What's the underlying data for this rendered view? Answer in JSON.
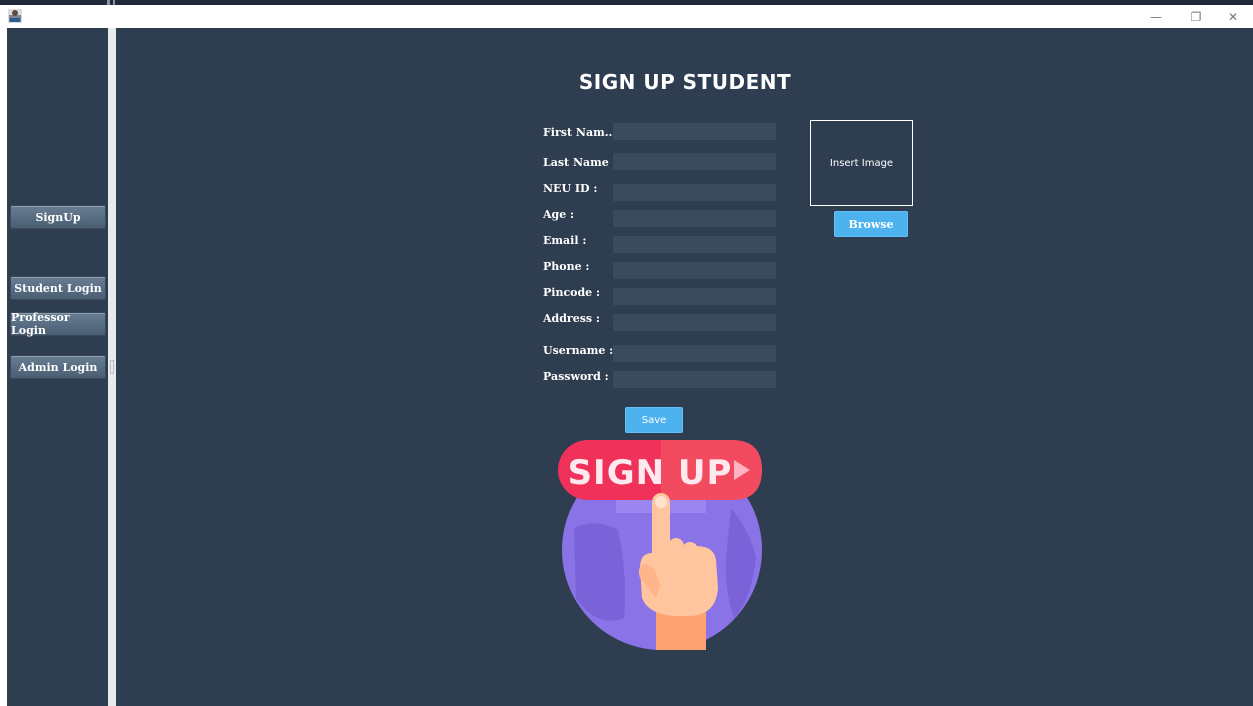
{
  "window": {
    "minimize_glyph": "—",
    "maximize_glyph": "❐",
    "close_glyph": "✕"
  },
  "sidebar": {
    "items": [
      {
        "label": "SignUp"
      },
      {
        "label": "Student Login"
      },
      {
        "label": "Professor Login"
      },
      {
        "label": "Admin Login"
      }
    ]
  },
  "form": {
    "title": "SIGN UP STUDENT",
    "fields": [
      {
        "label": "First Nam...",
        "value": ""
      },
      {
        "label": "Last Name :",
        "value": ""
      },
      {
        "label": "NEU ID :",
        "value": ""
      },
      {
        "label": "Age :",
        "value": ""
      },
      {
        "label": "Email :",
        "value": ""
      },
      {
        "label": "Phone :",
        "value": ""
      },
      {
        "label": "Pincode :",
        "value": ""
      },
      {
        "label": "Address :",
        "value": ""
      },
      {
        "label": "Username :",
        "value": ""
      },
      {
        "label": "Password :",
        "value": ""
      }
    ],
    "image_placeholder": "Insert Image",
    "browse_label": "Browse",
    "save_label": "Save"
  },
  "illustration": {
    "banner_text": "SIGN UP",
    "icon": "hand-pointer-icon"
  },
  "colors": {
    "background": "#2e3e50",
    "accent_blue": "#4db3ef",
    "banner_red": "#f0315a",
    "circle_purple": "#8a73e6"
  }
}
